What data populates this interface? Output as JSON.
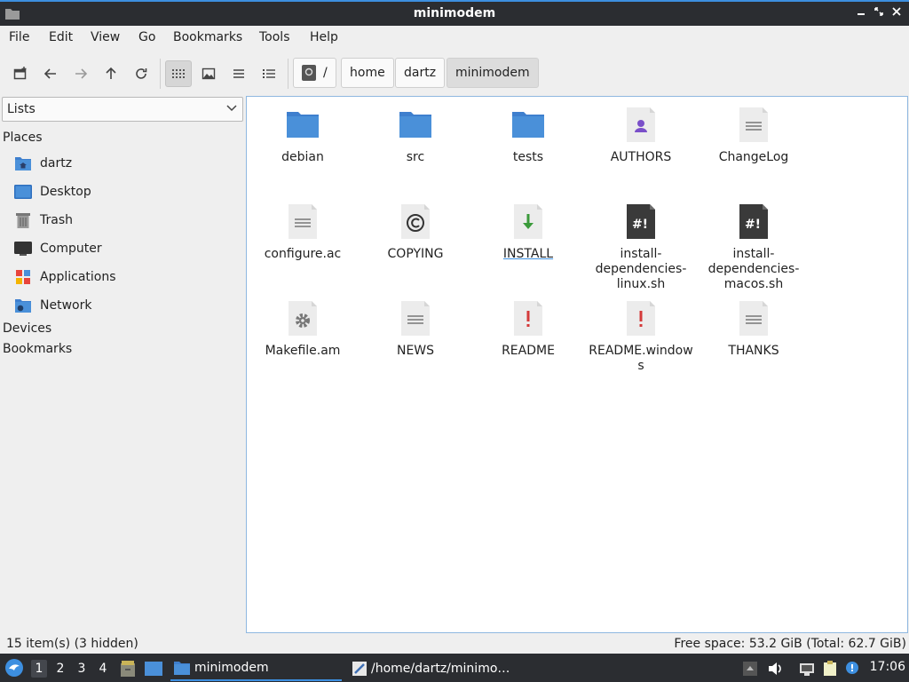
{
  "window": {
    "title": "minimodem"
  },
  "menu": [
    "File",
    "Edit",
    "View",
    "Go",
    "Bookmarks",
    "Tools",
    "Help"
  ],
  "breadcrumb": [
    "/",
    "home",
    "dartz",
    "minimodem"
  ],
  "sidepanel": {
    "mode": "Lists",
    "places_label": "Places",
    "places": [
      "dartz",
      "Desktop",
      "Trash",
      "Computer",
      "Applications",
      "Network"
    ],
    "devices_label": "Devices",
    "bookmarks_label": "Bookmarks"
  },
  "files": [
    {
      "name": "debian",
      "type": "folder"
    },
    {
      "name": "src",
      "type": "folder"
    },
    {
      "name": "tests",
      "type": "folder"
    },
    {
      "name": "AUTHORS",
      "type": "person-doc"
    },
    {
      "name": "ChangeLog",
      "type": "text-doc"
    },
    {
      "name": "configure.ac",
      "type": "text-doc"
    },
    {
      "name": "COPYING",
      "type": "copyright-doc"
    },
    {
      "name": "INSTALL",
      "type": "install-doc"
    },
    {
      "name": "install-dependencies-linux.sh",
      "type": "script"
    },
    {
      "name": "install-dependencies-macos.sh",
      "type": "script"
    },
    {
      "name": "Makefile.am",
      "type": "gear-doc"
    },
    {
      "name": "NEWS",
      "type": "text-doc"
    },
    {
      "name": "README",
      "type": "important-doc"
    },
    {
      "name": "README.windows",
      "type": "important-doc"
    },
    {
      "name": "THANKS",
      "type": "text-doc"
    }
  ],
  "status": {
    "items": "15 item(s) (3 hidden)",
    "free_space": "Free space: 53.2 GiB (Total: 62.7 GiB)"
  },
  "taskbar": {
    "workspaces": [
      "1",
      "2",
      "3",
      "4"
    ],
    "tasks": [
      "minimodem",
      "/home/dartz/minimo…"
    ],
    "clock": "17:06"
  },
  "colors": {
    "accent": "#3d8fe0",
    "folder": "#4a90d9",
    "panel": "#2b2d31"
  }
}
